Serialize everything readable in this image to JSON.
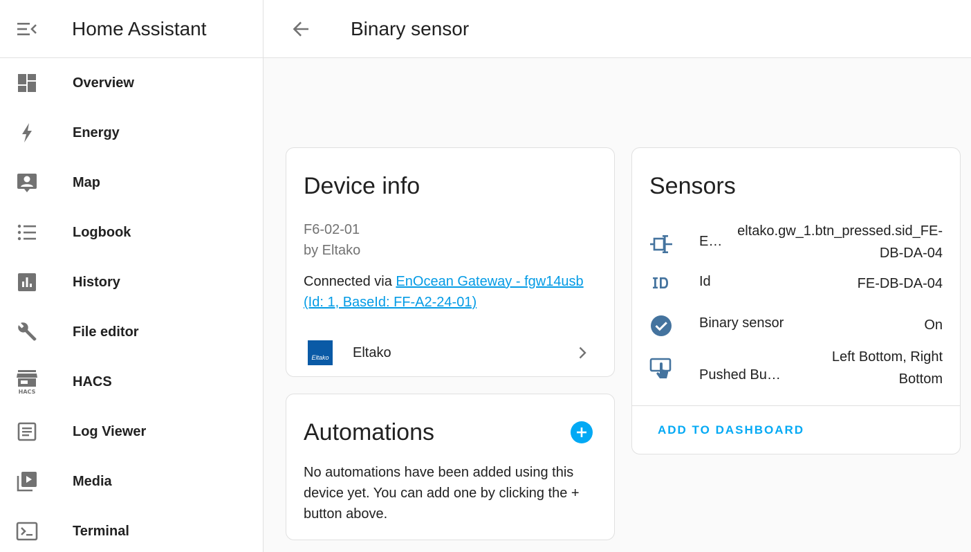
{
  "sidebar": {
    "title": "Home Assistant",
    "items": [
      {
        "label": "Overview",
        "icon": "view-dashboard-icon"
      },
      {
        "label": "Energy",
        "icon": "lightning-bolt-icon"
      },
      {
        "label": "Map",
        "icon": "account-box-icon"
      },
      {
        "label": "Logbook",
        "icon": "format-list-bulleted-icon"
      },
      {
        "label": "History",
        "icon": "chart-box-icon"
      },
      {
        "label": "File editor",
        "icon": "wrench-icon"
      },
      {
        "label": "HACS",
        "icon": "hacs-store-icon"
      },
      {
        "label": "Log Viewer",
        "icon": "text-box-icon"
      },
      {
        "label": "Media",
        "icon": "play-box-multiple-icon"
      },
      {
        "label": "Terminal",
        "icon": "console-icon"
      }
    ],
    "hacs_icon_text": "HACS"
  },
  "header": {
    "title": "Binary sensor"
  },
  "device_info": {
    "title": "Device info",
    "model": "F6-02-01",
    "manufacturer": "by Eltako",
    "connected_prefix": "Connected via ",
    "connected_link": "EnOcean Gateway - fgw14usb (Id: 1, BaseId: FF-A2-24-01)",
    "brand_name": "Eltako",
    "brand_logo_text": "Eltako"
  },
  "automations": {
    "title": "Automations",
    "empty_text": "No automations have been added using this device yet. You can add one by clicking the + button above."
  },
  "sensors": {
    "title": "Sensors",
    "rows": [
      {
        "name": "E…",
        "value": "eltako.gw_1.btn_pressed.sid_FE-DB-DA-04",
        "icon": "connection-icon"
      },
      {
        "name": "Id",
        "value": "FE-DB-DA-04",
        "icon": "id-icon"
      },
      {
        "name": "Binary sensor",
        "value": "On",
        "icon": "check-circle-icon"
      },
      {
        "name": "Pushed Bu…",
        "value": "Left Bottom, Right Bottom",
        "icon": "gesture-tap-button-icon"
      }
    ],
    "add_to_dashboard": "ADD TO DASHBOARD"
  },
  "colors": {
    "accent": "#03a9f4",
    "icon_blue": "#44739e",
    "sidebar_icon": "#727272"
  }
}
